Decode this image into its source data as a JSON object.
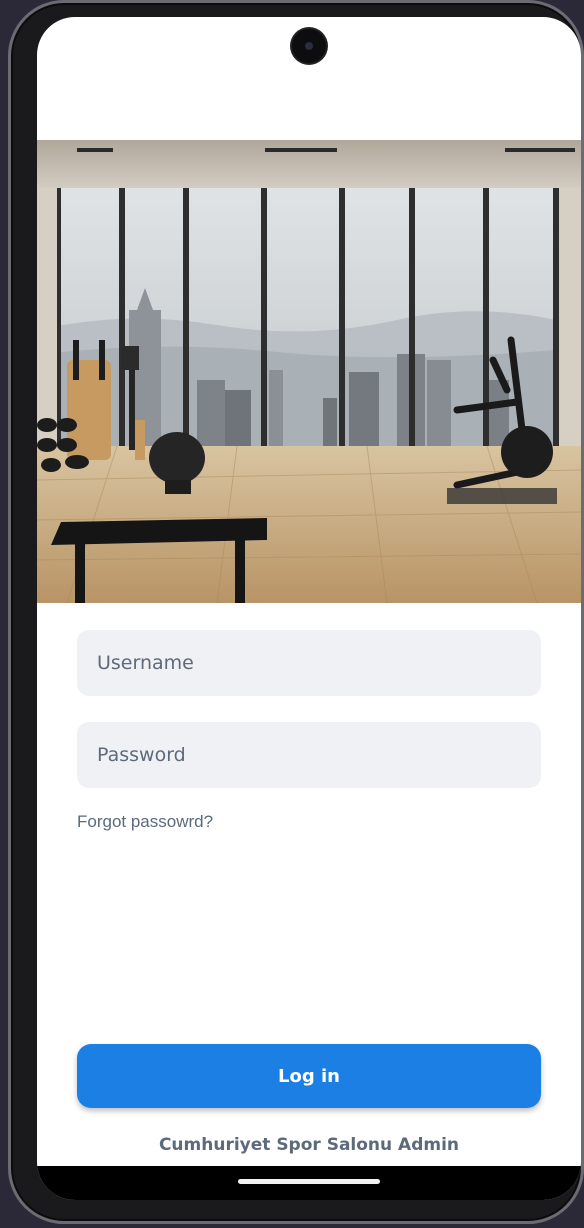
{
  "login": {
    "username_placeholder": "Username",
    "password_placeholder": "Password",
    "forgot_label": "Forgot passowrd?",
    "login_label": "Log in",
    "footer_text": "Cumhuriyet Spor Salonu Admin"
  },
  "hero": {
    "description_icon": "gym-photo"
  },
  "colors": {
    "accent": "#1b7fe4",
    "field_bg": "#f0f1f4",
    "muted_text": "#5d6a7c"
  }
}
